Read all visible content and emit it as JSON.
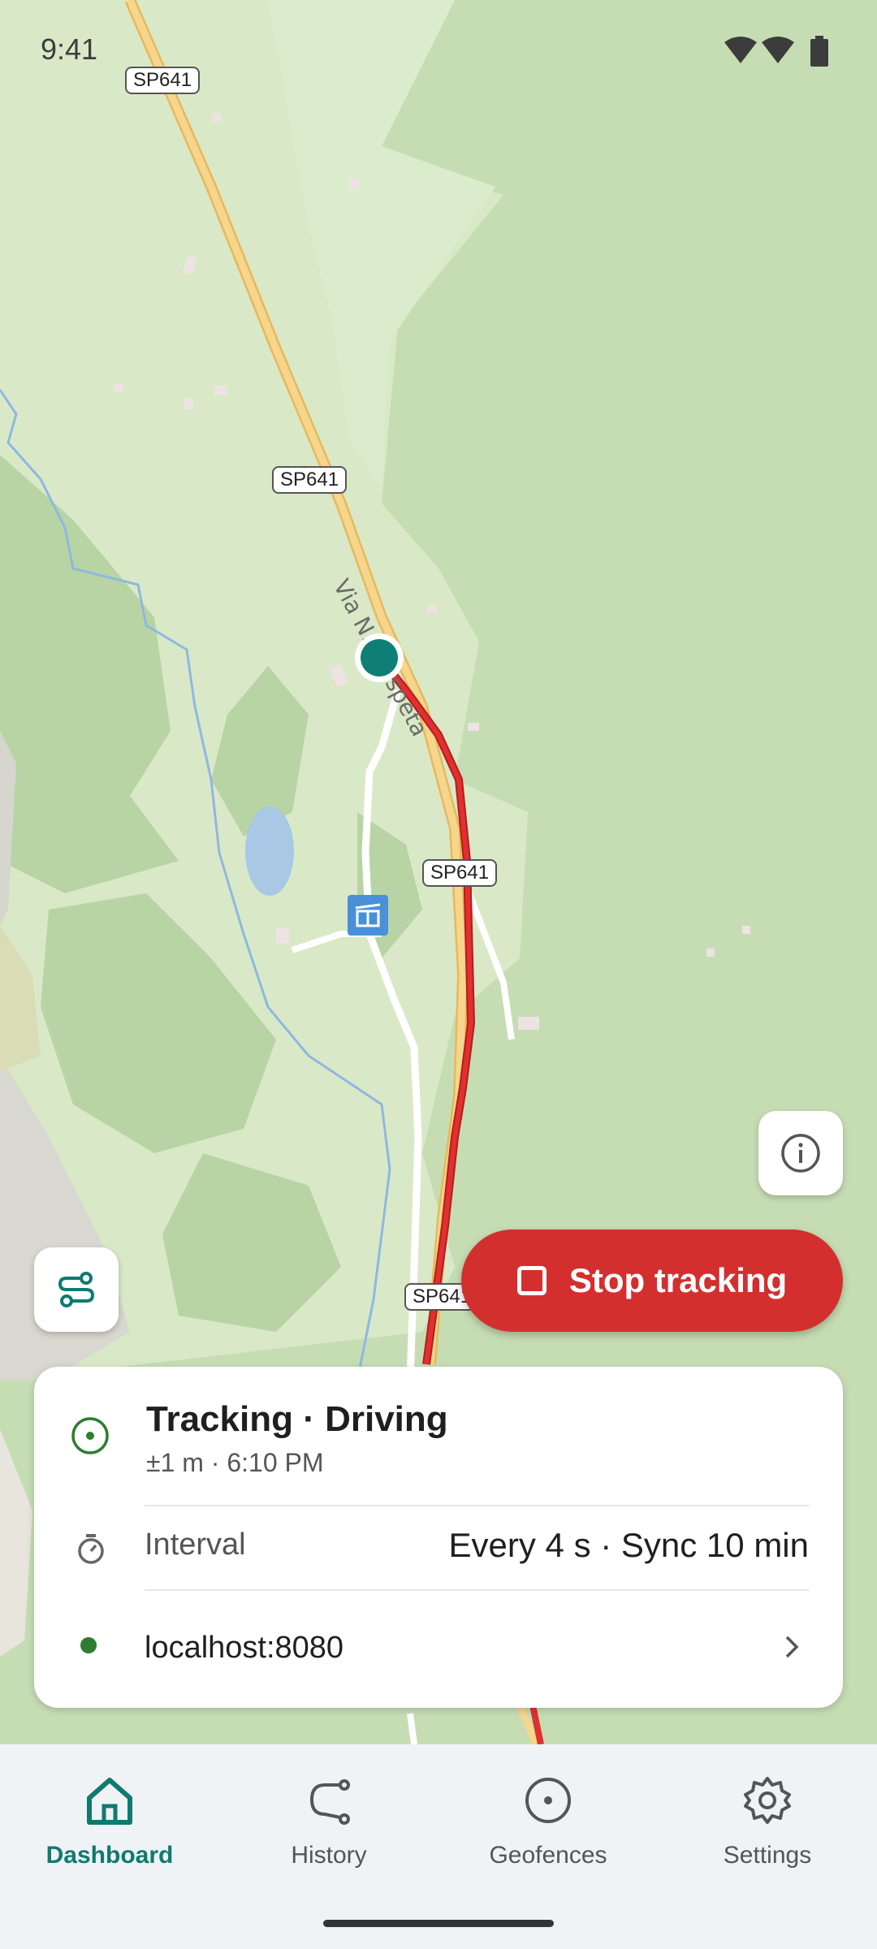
{
  "status_bar": {
    "time": "9:41"
  },
  "map": {
    "road_labels": [
      "SP641",
      "SP641",
      "SP641",
      "SP641"
    ],
    "street_label": "Via N... Cispeta",
    "colors": {
      "track": "#d32f2f",
      "position": "#0f7f75",
      "lake": "#a8c8e6",
      "highway": "#f6d58c"
    }
  },
  "controls": {
    "info_icon": "info-icon",
    "layers_icon": "route-icon",
    "stop_label": "Stop tracking"
  },
  "status_card": {
    "title": "Tracking · Driving",
    "subtitle": "±1 m · 6:10 PM",
    "interval_label": "Interval",
    "interval_value": "Every 4 s · Sync 10 min",
    "server": "localhost:8080"
  },
  "nav": {
    "items": [
      {
        "label": "Dashboard",
        "icon": "home-icon",
        "active": true
      },
      {
        "label": "History",
        "icon": "history-route-icon",
        "active": false
      },
      {
        "label": "Geofences",
        "icon": "geofence-icon",
        "active": false
      },
      {
        "label": "Settings",
        "icon": "gear-icon",
        "active": false
      }
    ]
  },
  "accent_color": "#0f7a70",
  "stop_color": "#d32f2f"
}
